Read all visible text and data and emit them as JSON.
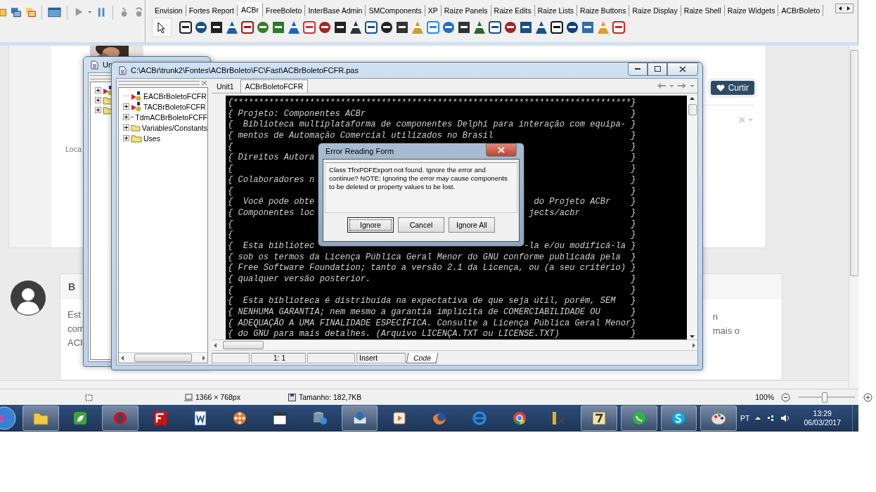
{
  "ide": {
    "palette_tabs": [
      {
        "label": "Envision",
        "selected": false
      },
      {
        "label": "Fortes Report",
        "selected": false
      },
      {
        "label": "ACBr",
        "selected": true
      },
      {
        "label": "FreeBoleto",
        "selected": false
      },
      {
        "label": "InterBase Admin",
        "selected": false
      },
      {
        "label": "SMComponents",
        "selected": false
      },
      {
        "label": "XP",
        "selected": false
      },
      {
        "label": "Raize Panels",
        "selected": false
      },
      {
        "label": "Raize Edits",
        "selected": false
      },
      {
        "label": "Raize Lists",
        "selected": false
      },
      {
        "label": "Raize Buttons",
        "selected": false
      },
      {
        "label": "Raize Display",
        "selected": false
      },
      {
        "label": "Raize Shell",
        "selected": false
      },
      {
        "label": "Raize Widgets",
        "selected": false
      },
      {
        "label": "ACBrBoleto",
        "selected": false
      }
    ]
  },
  "web_page": {
    "location_text": "Loca",
    "like_button": "Curtir",
    "comment": {
      "author": "B",
      "left_fragments": [
        "Est",
        "com",
        "ACI"
      ],
      "right_fragments": [
        "n",
        "mais o"
      ]
    }
  },
  "back_window": {
    "title": "Un",
    "tree_items": [
      {
        "kind": "component"
      },
      {
        "kind": "folder"
      },
      {
        "kind": "folder"
      }
    ]
  },
  "editor_window": {
    "title": "C:\\ACBr\\trunk2\\Fontes\\ACBrBoleto\\FC\\Fast\\ACBrBoletoFCFR.pas",
    "tree_items": [
      {
        "label": "EACBrBoletoFCFR",
        "kind": "component",
        "has_children": false
      },
      {
        "label": "TACBrBoletoFCFR",
        "kind": "component",
        "has_children": true
      },
      {
        "label": "TdmACBrBoletoFCFF",
        "kind": "component",
        "has_children": true
      },
      {
        "label": "Variables/Constants",
        "kind": "folder",
        "has_children": true
      },
      {
        "label": "Uses",
        "kind": "folder",
        "has_children": true
      }
    ],
    "tabs": [
      {
        "label": "Unit1",
        "selected": false
      },
      {
        "label": "ACBrBoletoFCFR",
        "selected": true
      }
    ],
    "code_lines": [
      {
        "left": "{******************************************************************************}"
      },
      {
        "left": "{ Projeto: Componentes ACBr",
        "right": "}"
      },
      {
        "left": "{  Biblioteca multiplataforma de componentes Delphi para interação com equipa-",
        "right": "}"
      },
      {
        "left": "{ mentos de Automação Comercial utilizados no Brasil",
        "right": "}"
      },
      {
        "left": "{",
        "right": "}"
      },
      {
        "left": "{ Direitos Autora",
        "right": "}"
      },
      {
        "left": "{",
        "right": "}"
      },
      {
        "left": "{ Colaboradores n",
        "right": "}"
      },
      {
        "left": "{",
        "right": "}"
      },
      {
        "left": "{  Você pode obte",
        "right": "do Projeto ACBr    }"
      },
      {
        "left": "{ Componentes loc",
        "right": "jects/acbr          }"
      },
      {
        "left": "{",
        "right": "}"
      },
      {
        "left": "{",
        "right": "}"
      },
      {
        "left": "{  Esta bibliotec",
        "right": "-la e/ou modificá-la }"
      },
      {
        "left": "{ sob os termos da Licença Pública Geral Menor do GNU conforme publicada pela",
        "right": "}"
      },
      {
        "left": "{ Free Software Foundation; tanto a versão 2.1 da Licença, ou (a seu critério)",
        "right": "}"
      },
      {
        "left": "{ qualquer versão posterior.",
        "right": "}"
      },
      {
        "left": "{",
        "right": "}"
      },
      {
        "left": "{  Esta biblioteca é distribuída na expectativa de que seja útil, porém, SEM",
        "right": "}"
      },
      {
        "left": "{ NENHUMA GARANTIA; nem mesmo a garantia implícita de COMERCIABILIDADE OU",
        "right": "}"
      },
      {
        "left": "{ ADEQUAÇÃO A UMA FINALIDADE ESPECÍFICA. Consulte a Licença Pública Geral Menor}"
      },
      {
        "left": "{ do GNU para mais detalhes. (Arquivo LICENÇA.TXT ou LICENSE.TXT)",
        "right": "}"
      }
    ],
    "status_bar": {
      "position": "1:  1",
      "mode": "Insert",
      "view_tab": "Code"
    }
  },
  "dialog": {
    "title": "Error Reading Form",
    "message": "Class TfrxPDFExport not found.  Ignore the error and continue?  NOTE: Ignoring the error may cause components to be deleted or property values to be lost.",
    "buttons": [
      {
        "label": "Ignore",
        "focused": true
      },
      {
        "label": "Cancel",
        "focused": false
      },
      {
        "label": "Ignore All",
        "focused": false
      }
    ]
  },
  "browser_status_bar": {
    "dimensions": "1366 × 768px",
    "size": "Tamanho: 182,7KB",
    "zoom": "100%",
    "zoom_slider": {
      "level": 0.45
    }
  },
  "taskbar": {
    "buttons": [
      {
        "running": true
      },
      {
        "running": false
      },
      {
        "running": true
      },
      {
        "running": false
      },
      {
        "running": false
      },
      {
        "running": false
      },
      {
        "running": false
      },
      {
        "running": false
      },
      {
        "running": true
      },
      {
        "running": false
      },
      {
        "running": false
      },
      {
        "running": false
      },
      {
        "running": false
      },
      {
        "running": false
      },
      {
        "running": true
      },
      {
        "running": true
      },
      {
        "running": true
      },
      {
        "running": true
      }
    ],
    "language": "PT",
    "time": "13:29",
    "date": "06/03/2017"
  }
}
